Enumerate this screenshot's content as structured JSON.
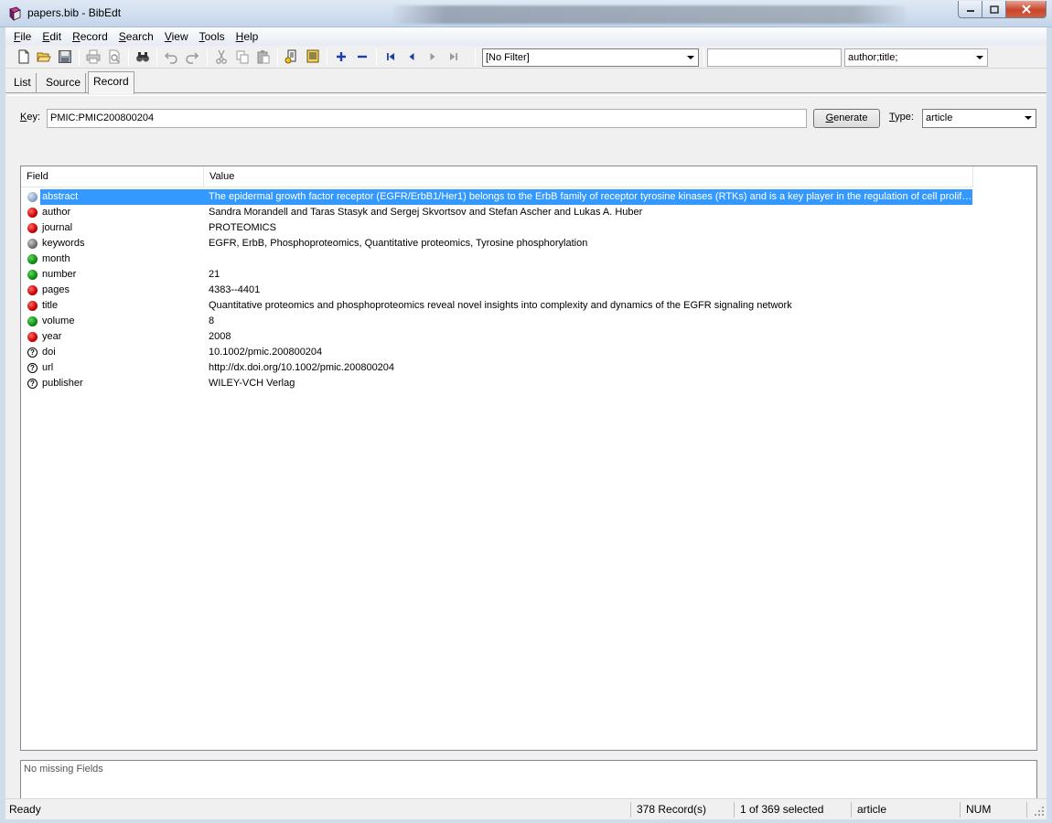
{
  "window": {
    "title": "papers.bib - BibEdt"
  },
  "menu": [
    {
      "pre": "",
      "u": "F",
      "post": "ile"
    },
    {
      "pre": "",
      "u": "E",
      "post": "dit"
    },
    {
      "pre": "",
      "u": "R",
      "post": "ecord"
    },
    {
      "pre": "",
      "u": "S",
      "post": "earch"
    },
    {
      "pre": "",
      "u": "V",
      "post": "iew"
    },
    {
      "pre": "",
      "u": "T",
      "post": "ools"
    },
    {
      "pre": "",
      "u": "H",
      "post": "elp"
    }
  ],
  "toolbar": {
    "filter_value": "[No Filter]",
    "search_value": "",
    "fields_value": "author;title;"
  },
  "tabs": [
    "List",
    "Source",
    "Record"
  ],
  "record": {
    "key_label_u": "K",
    "key_label_rest": "ey:",
    "key_value": "PMIC:PMIC200800204",
    "generate_label_u": "G",
    "generate_label_rest": "enerate",
    "type_label_u": "T",
    "type_label_rest": "ype:",
    "type_value": "article"
  },
  "grid": {
    "columns": [
      "Field",
      "Value"
    ],
    "rows": [
      {
        "status": "blue",
        "field": "abstract",
        "value": "The epidermal growth factor receptor (EGFR/ErbB1/Her1) belongs to the ErbB family of receptor tyrosine kinases (RTKs) and is a key player in the regulation of cell proliferation, differentiation and migration"
      },
      {
        "status": "red",
        "field": "author",
        "value": "Sandra Morandell and Taras Stasyk and Sergej Skvortsov and Stefan Ascher and Lukas A. Huber"
      },
      {
        "status": "red",
        "field": "journal",
        "value": "PROTEOMICS"
      },
      {
        "status": "gray",
        "field": "keywords",
        "value": "EGFR, ErbB, Phosphoproteomics, Quantitative proteomics, Tyrosine phosphorylation"
      },
      {
        "status": "green",
        "field": "month",
        "value": ""
      },
      {
        "status": "green",
        "field": "number",
        "value": "21"
      },
      {
        "status": "red",
        "field": "pages",
        "value": "4383--4401"
      },
      {
        "status": "red",
        "field": "title",
        "value": "Quantitative proteomics and phosphoproteomics reveal novel insights into complexity and dynamics of the EGFR signaling network"
      },
      {
        "status": "green",
        "field": "volume",
        "value": "8"
      },
      {
        "status": "red",
        "field": "year",
        "value": "2008"
      },
      {
        "status": "question",
        "field": "doi",
        "value": "10.1002/pmic.200800204"
      },
      {
        "status": "question",
        "field": "url",
        "value": "http://dx.doi.org/10.1002/pmic.200800204"
      },
      {
        "status": "question",
        "field": "publisher",
        "value": "WILEY-VCH Verlag"
      }
    ]
  },
  "missing_text": "No missing Fields",
  "status": {
    "state": "Ready",
    "records": "378 Record(s)",
    "selection": "1 of 369 selected",
    "type": "article",
    "num": "NUM"
  }
}
